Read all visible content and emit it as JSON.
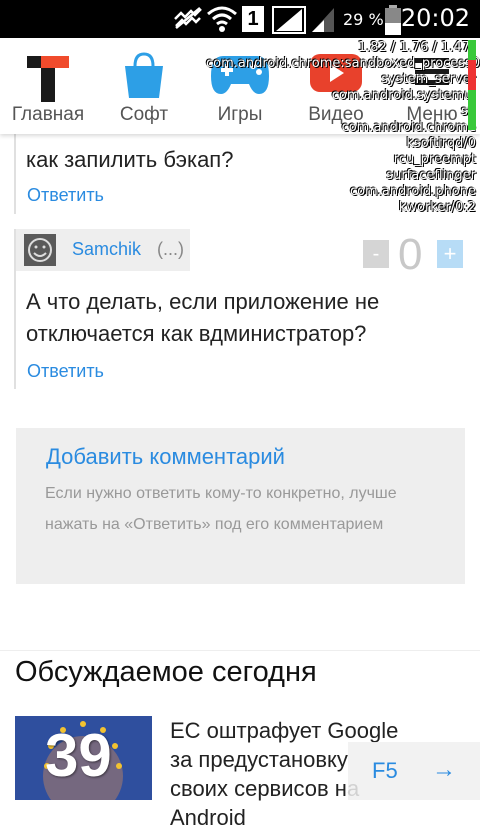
{
  "status_bar": {
    "battery_percent": "29 %",
    "time": "20:02",
    "sim_label": "1"
  },
  "nav": {
    "items": [
      {
        "label": "Главная"
      },
      {
        "label": "Софт"
      },
      {
        "label": "Игры"
      },
      {
        "label": "Видео"
      },
      {
        "label": "Меню"
      }
    ]
  },
  "overlay": {
    "loads": [
      "1.82",
      "1.76",
      "1.47"
    ],
    "processes": [
      "com.android.chrome:sandboxed_process0",
      "system_server",
      "com.android.systemui",
      "su",
      "com.android.chrome",
      "ksoftirqd/0",
      "rcu_preempt",
      "surfaceflinger",
      "com.android.phone",
      "kworker/0:2"
    ]
  },
  "comments": {
    "prev_text": "как запилить бэкап?",
    "prev_reply": "Ответить",
    "author": "Samchik",
    "author_extra": "(...)",
    "vote_minus": "-",
    "vote_count": "0",
    "vote_plus": "+",
    "text": "А что делать, если приложение не отключается как вдминистратор?",
    "reply": "Ответить"
  },
  "add_comment": {
    "title": "Добавить комментарий",
    "hint": "Если нужно ответить кому-то конкретно, лучше нажать на «Ответить» под его комментарием"
  },
  "discussed": {
    "title": "Обсуждаемое сегодня",
    "article_count": "39",
    "headline": "ЕС оштрафует Google за предустановку своих сервисов на Android"
  },
  "floating": {
    "f5": "F5",
    "arrow": "→"
  },
  "colors": {
    "accent": "#2a8be0",
    "status_bar": "#000000"
  }
}
